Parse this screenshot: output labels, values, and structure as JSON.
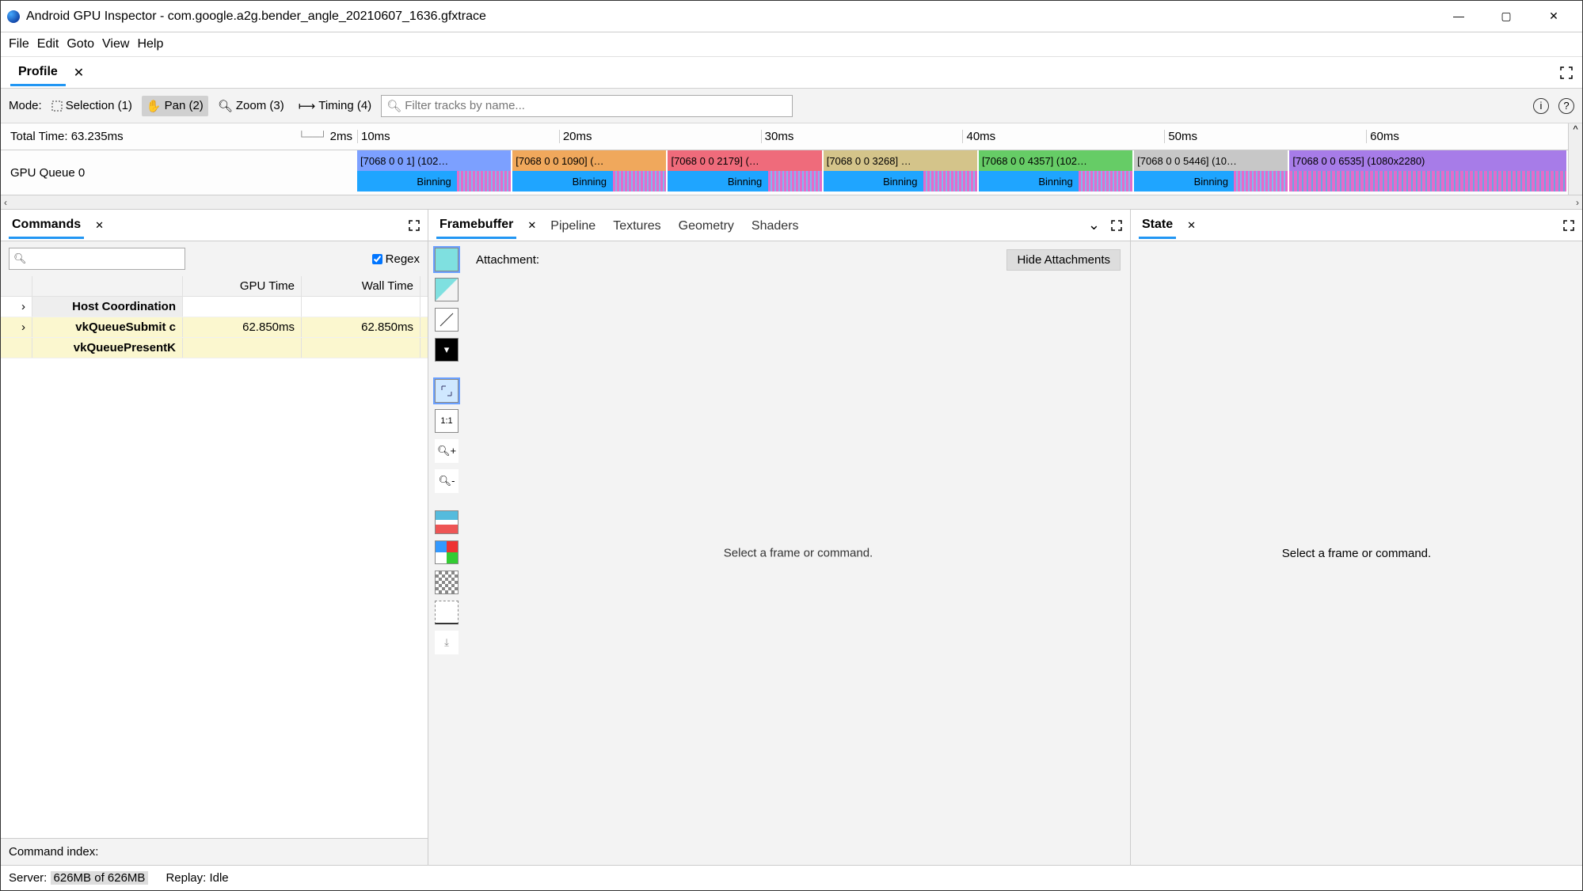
{
  "window": {
    "app_name": "Android GPU Inspector",
    "file_name": "com.google.a2g.bender_angle_20210607_1636.gfxtrace"
  },
  "menu": {
    "file": "File",
    "edit": "Edit",
    "goto": "Goto",
    "view": "View",
    "help": "Help"
  },
  "profile_tab": {
    "label": "Profile"
  },
  "toolbar": {
    "mode_label": "Mode:",
    "selection": "Selection (1)",
    "pan": "Pan (2)",
    "zoom": "Zoom (3)",
    "timing": "Timing (4)",
    "filter_placeholder": "Filter tracks by name..."
  },
  "timeline": {
    "total_time_label": "Total Time:",
    "total_time_value": "63.235ms",
    "scale_hint": "2ms",
    "ticks": [
      "10ms",
      "20ms",
      "30ms",
      "40ms",
      "50ms",
      "60ms"
    ],
    "queue_label": "GPU Queue 0",
    "bars": [
      {
        "top": "[7068 0 0 1] (102…",
        "color": "#7ca0ff",
        "binning": "Binning"
      },
      {
        "top": "[7068 0 0 1090] (…",
        "color": "#f0a85c",
        "binning": "Binning"
      },
      {
        "top": "[7068 0 0 2179] (…",
        "color": "#ef6b7b",
        "binning": "Binning"
      },
      {
        "top": "[7068 0 0 3268] …",
        "color": "#d4c48a",
        "binning": "Binning"
      },
      {
        "top": "[7068 0 0 4357] (102…",
        "color": "#66cc66",
        "binning": "Binning"
      },
      {
        "top": "[7068 0 0 5446] (10…",
        "color": "#c7c7c7",
        "binning": "Binning"
      },
      {
        "top": "[7068 0 0 6535] (1080x2280)",
        "color": "#a77ce8",
        "binning": ""
      }
    ]
  },
  "commands": {
    "tab_label": "Commands",
    "regex_label": "Regex",
    "col_gpu": "GPU Time",
    "col_wall": "Wall Time",
    "rows": [
      {
        "name": "Host Coordination",
        "gpu": "",
        "wall": "",
        "section": true,
        "expand": true
      },
      {
        "name": "vkQueueSubmit c",
        "gpu": "62.850ms",
        "wall": "62.850ms",
        "section": false,
        "expand": true,
        "hl": true
      },
      {
        "name": "vkQueuePresentK",
        "gpu": "",
        "wall": "",
        "section": false,
        "expand": false,
        "hl": true
      }
    ],
    "footer": "Command index:"
  },
  "center_tabs": {
    "framebuffer": "Framebuffer",
    "pipeline": "Pipeline",
    "textures": "Textures",
    "geometry": "Geometry",
    "shaders": "Shaders",
    "attachment_label": "Attachment:",
    "hide_label": "Hide Attachments",
    "empty_msg": "Select a frame or command."
  },
  "state": {
    "tab_label": "State",
    "empty_msg": "Select a frame or command."
  },
  "status": {
    "server_label": "Server:",
    "server_mem": "626MB of 626MB",
    "replay_label": "Replay:",
    "replay_val": "Idle"
  }
}
